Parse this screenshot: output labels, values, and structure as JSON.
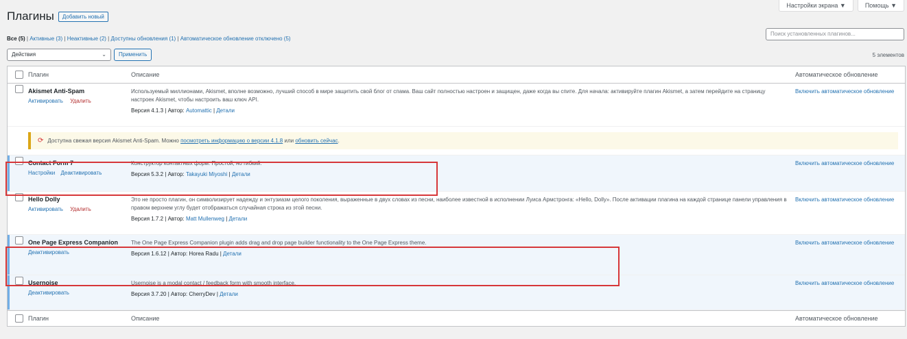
{
  "screen_options": {
    "options_label": "Настройки экрана ▼",
    "help_label": "Помощь ▼"
  },
  "header": {
    "title": "Плагины",
    "add_new_label": "Добавить новый"
  },
  "filters": {
    "all": "Все (5)",
    "active": "Активные (3)",
    "inactive": "Неактивные (2)",
    "updates": "Доступны обновления (1)",
    "auto_updates_disabled": "Автоматическое обновление отключено (5)"
  },
  "search": {
    "placeholder": "Поиск установленных плагинов..."
  },
  "bulk_actions": {
    "selected": "Действия",
    "apply_label": "Применить"
  },
  "items_count": "5 элементов",
  "table": {
    "col_plugin": "Плагин",
    "col_description": "Описание",
    "col_auto_updates": "Автоматическое обновление",
    "rows": [
      {
        "name": "Akismet Anti-Spam",
        "action1": "Активировать",
        "action2": "Удалить",
        "description": "Используемый миллионами, Akismet, вполне возможно, лучший способ в мире защитить свой блог от спама. Ваш сайт полностью настроен и защищен, даже когда вы спите. Для начала: активируйте плагин Akismet, а затем перейдите на страницу настроек Akismet, чтобы настроить ваш ключ API.",
        "version": "Версия 4.1.3",
        "author_label": "Автор:",
        "author": "Automattic",
        "details": "Детали",
        "auto_update": "Включить автоматическое обновление"
      },
      {
        "name": "Contact Form 7",
        "action1": "Настройки",
        "action2": "Деактивировать",
        "description": "Конструктор контактных форм. Простой, но гибкий.",
        "version": "Версия 5.3.2",
        "author_label": "Автор:",
        "author": "Takayuki Miyoshi",
        "details": "Детали",
        "auto_update": "Включить автоматическое обновление"
      },
      {
        "name": "Hello Dolly",
        "action1": "Активировать",
        "action2": "Удалить",
        "description": "Это не просто плагин, он символизирует надежду и энтузиазм целого поколения, выраженные в двух словах из песни, наиболее известной в исполнении Луиса Армстронга: «Hello, Dolly». После активации плагина на каждой странице панели управления в правом верхнем углу будет отображаться случайная строка из этой песни.",
        "version": "Версия 1.7.2",
        "author_label": "Автор:",
        "author": "Matt Mullenweg",
        "details": "Детали",
        "auto_update": "Включить автоматическое обновление"
      },
      {
        "name": "One Page Express Companion",
        "action1": "Деактивировать",
        "description": "The One Page Express Companion plugin adds drag and drop page builder functionality to the One Page Express theme.",
        "version": "Версия 1.6.12",
        "author_label": "Автор:",
        "author": "Horea Radu",
        "details": "Детали",
        "auto_update": "Включить автоматическое обновление"
      },
      {
        "name": "Usernoise",
        "action1": "Деактивировать",
        "description": "Usernoise is a modal contact / feedback form with smooth interface.",
        "version": "Версия 3.7.20",
        "author_label": "Автор:",
        "author": "CherryDev",
        "details": "Детали",
        "auto_update": "Включить автоматическое обновление"
      }
    ]
  },
  "akismet_notice": {
    "text_before": "Доступна свежая версия Akismet Anti-Spam. Можно",
    "link_details": "посмотреть информацию о версии 4.1.8",
    "text_or": "или",
    "link_update": "обновить сейчас",
    "text_end": "."
  },
  "colors": {
    "accent": "#2271b1",
    "highlight": "#d63638",
    "active_border": "#72aee6",
    "notice_bg": "#fcf9e8"
  }
}
